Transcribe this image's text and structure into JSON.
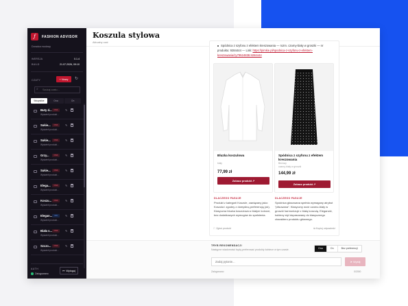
{
  "sidebar": {
    "brand_title": "FASHION ADVISOR",
    "brand_sub": "Doradca modowy",
    "version_key": "WERSJA",
    "version_val": "0.1.4",
    "build_key": "BUILD",
    "build_val": "21.07.2026, 09:10",
    "section_label": "CZATY",
    "new_button": "+ Nowy",
    "search_placeholder": "Szukaj czatu...",
    "tabs": [
      "Wszystkie",
      "Ona",
      "On"
    ],
    "items": [
      {
        "title": "Buty d...",
        "sub": "Wyświetl produkt...",
        "badge": "ONA",
        "badge_color": "red"
      },
      {
        "title": "Sukie...",
        "sub": "Wyświetl produkt...",
        "badge": "ONA",
        "badge_color": "red"
      },
      {
        "title": "Sukie...",
        "sub": "Wyświetl produkt...",
        "badge": "ONA",
        "badge_color": "red"
      },
      {
        "title": "Grzy...",
        "sub": "Wyświetl produkt...",
        "badge": "ONA",
        "badge_color": "red"
      },
      {
        "title": "Sukie...",
        "sub": "Wyświetl produkt...",
        "badge": "ONA",
        "badge_color": "red"
      },
      {
        "title": "Elega...",
        "sub": "Wyświetl produkt...",
        "badge": "ONA",
        "badge_color": "red"
      },
      {
        "title": "Koszu...",
        "sub": "Wyświetl produkt...",
        "badge": "ONA",
        "badge_color": "red"
      },
      {
        "title": "Elegan...",
        "sub": "Wyświetl produkt...",
        "badge": "ON",
        "badge_color": "blue"
      },
      {
        "title": "Biała s...",
        "sub": "Wyświetl produkt...",
        "badge": "ONA",
        "badge_color": "red"
      },
      {
        "title": "Szczo...",
        "sub": "Wyświetl produkt...",
        "badge": "ONA",
        "badge_color": "red"
      }
    ],
    "auth_label": "AUTH",
    "auth_status": "Zalogowano",
    "logout": "Wyloguj"
  },
  "main": {
    "title": "Koszula stylowa",
    "subtitle": "Aktualny czat",
    "message_line1": "Spódnica z szyfonu z efektem kreszowania — rozm. czarny-biały w groszki — nr",
    "message_line2": "produktu: 9284444 — Link:",
    "message_link": "https://pimkie.pl/spodnica-z-szyfonu-z-efektem-kreszowania/zy79524838.9284444",
    "cards": [
      {
        "name": "Bluzka koszulowa",
        "line1": "biały",
        "line2": "",
        "price": "77,99 zł",
        "button": "Zobacz produkt ↗"
      },
      {
        "name": "Spódnica z szyfonu z efektem kreszowania",
        "line1": "Beżowy",
        "line2": "czarny-biały w groszki",
        "price": "144,99 zł",
        "button": "Zobacz produkt ↗"
      }
    ],
    "reasons": [
      {
        "heading": "DLACZEGO PASUJE",
        "body": "Produkt z kategorii Koszule, zawiązany jako: Koszula i zgodny z domyślną preferencją (ok). Klasyczna bluzka koszulowa w białym kolorze, bez dodatkowych wymogów do spełnienia."
      },
      {
        "heading": "DLACZEGO PASUJE",
        "body": "Spódnica głosowana spełnia wymagany atrybut \"plisowana\". Klasyczny wzór czarno-biały w groszki harmonizuje z białą koszulą. Elegancki, kobiecy styl dopasowany do klasycznego charakteru produktu głównego."
      }
    ],
    "footer_left": "Zgłoś produkt",
    "footer_right": "Kopiuj odpowiedź"
  },
  "bottom": {
    "mode_label": "TRYB REKOMENDACJI",
    "mode_sub": "Następne wiadomości będą preferować produkty kobiece w tym czasie.",
    "seg": [
      "Ona",
      "On",
      "Bez preferencji"
    ],
    "prompt_placeholder": "Zadaj pytanie...",
    "send": "➤ Wyślij",
    "status_left": "Zalogowano",
    "status_right": "0/2000"
  }
}
